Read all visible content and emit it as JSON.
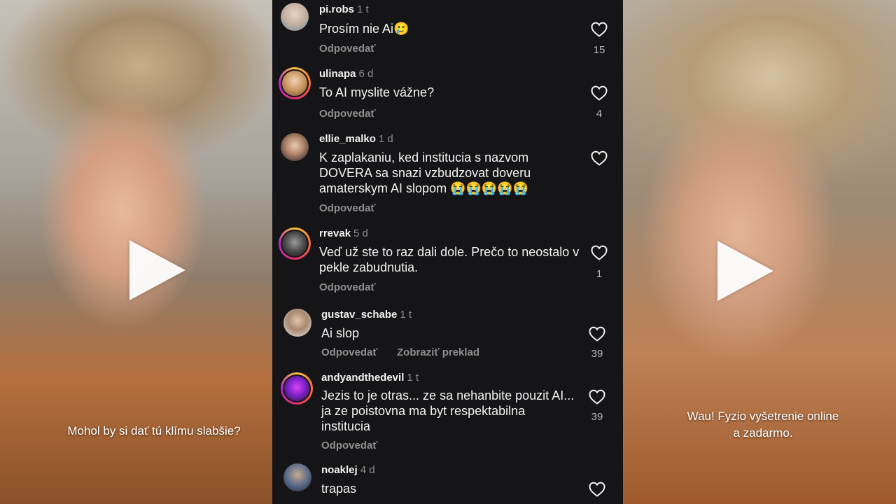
{
  "left_video": {
    "caption": "Mohol by si dať tú klímu slabšie?"
  },
  "right_video": {
    "caption_line1": "Wau! Fyzio vyšetrenie online",
    "caption_line2": "a zadarmo."
  },
  "comments": [
    {
      "username": "pi.robs",
      "time": "1 t",
      "text": "Prosím nie Ai🥲",
      "reply": "Odpovedať",
      "likes": "15"
    },
    {
      "username": "ulinapa",
      "time": "6 d",
      "text": "To AI myslite vážne?",
      "reply": "Odpovedať",
      "likes": "4"
    },
    {
      "username": "ellie_malko",
      "time": "1 d",
      "text": "K zaplakaniu, ked institucia s nazvom DOVERA sa snazi vzbudzovat doveru amaterskym AI slopom 😭😭😭😭😭",
      "reply": "Odpovedať",
      "likes": ""
    },
    {
      "username": "rrevak",
      "time": "5 d",
      "text": "Veď už ste to raz dali dole. Prečo to neostalo v pekle zabudnutia.",
      "reply": "Odpovedať",
      "likes": "1"
    },
    {
      "username": "gustav_schabe",
      "time": "1 t",
      "text": "Ai slop",
      "reply": "Odpovedať",
      "translate": "Zobraziť preklad",
      "likes": "39"
    },
    {
      "username": "andyandthedevil",
      "time": "1 t",
      "text": "Jezis to je otras... ze sa nehanbite pouzit AI... ja ze poistovna ma byt respektabilna institucia",
      "reply": "Odpovedať",
      "likes": "39"
    },
    {
      "username": "noaklej",
      "time": "4 d",
      "text": "trapas",
      "reply": "",
      "likes": ""
    }
  ],
  "icons": {
    "heart": "heart-outline-icon",
    "play": "play-icon"
  },
  "colors": {
    "panel_bg": "#151517",
    "text": "#f2f2f2",
    "muted": "#8e8e8e",
    "story_ring": "#e1306c"
  }
}
